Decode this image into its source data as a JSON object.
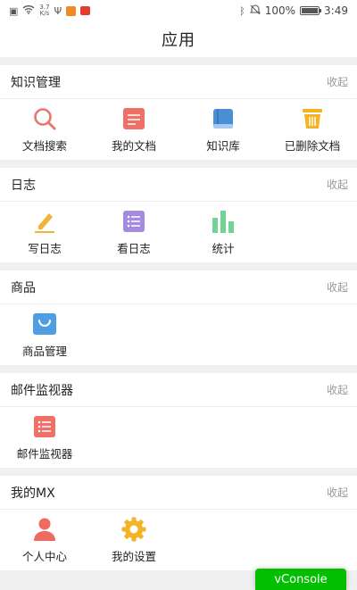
{
  "status_bar": {
    "speed_value": "3.7",
    "speed_unit": "K/s",
    "battery": "100%",
    "battery_level": 1.0,
    "time": "3:49"
  },
  "header": {
    "title": "应用"
  },
  "collapse_label": "收起",
  "sections": [
    {
      "title": "知识管理",
      "items": [
        {
          "label": "文档搜索",
          "icon": "search-icon",
          "color": "#e8776a"
        },
        {
          "label": "我的文档",
          "icon": "document-icon",
          "color": "#ee7066"
        },
        {
          "label": "知识库",
          "icon": "book-icon",
          "color": "#4a8fd6"
        },
        {
          "label": "已删除文档",
          "icon": "trash-icon",
          "color": "#f3b324"
        }
      ]
    },
    {
      "title": "日志",
      "items": [
        {
          "label": "写日志",
          "icon": "pencil-icon",
          "color": "#f0b43b"
        },
        {
          "label": "看日志",
          "icon": "list-icon",
          "color": "#a68ae0"
        },
        {
          "label": "统计",
          "icon": "bar-chart-icon",
          "color": "#6fd494"
        }
      ]
    },
    {
      "title": "商品",
      "items": [
        {
          "label": "商品管理",
          "icon": "shopping-bag-icon",
          "color": "#4f9ee3"
        }
      ]
    },
    {
      "title": "邮件监视器",
      "items": [
        {
          "label": "邮件监视器",
          "icon": "list-icon",
          "color": "#ee7066"
        }
      ]
    },
    {
      "title": "我的MX",
      "items": [
        {
          "label": "个人中心",
          "icon": "person-icon",
          "color": "#ee6b60"
        },
        {
          "label": "我的设置",
          "icon": "gear-icon",
          "color": "#f3b324"
        }
      ]
    }
  ],
  "vconsole_label": "vConsole"
}
